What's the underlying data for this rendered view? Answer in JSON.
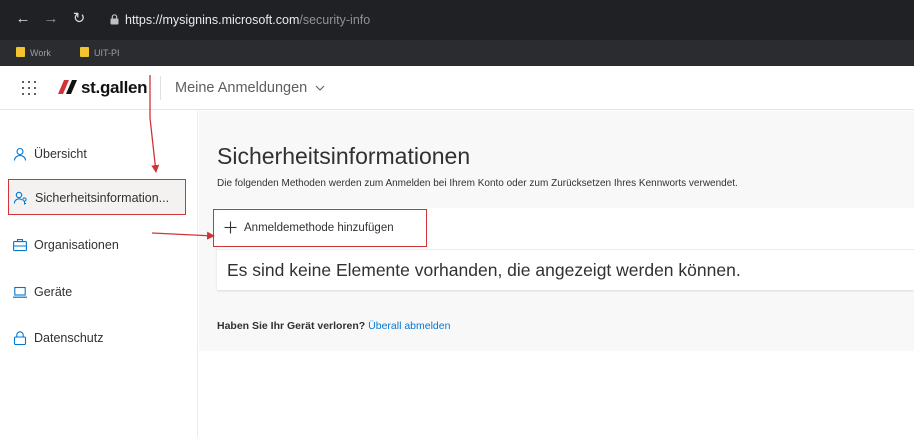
{
  "browser": {
    "url_host": "https://mysignins.microsoft.com",
    "url_path": "/security-info",
    "bookmarks": [
      {
        "label": "Work",
        "icon": "folder-icon"
      },
      {
        "label": "UIT-PI",
        "icon": "folder-icon"
      }
    ]
  },
  "header": {
    "logo_text": "st.gallen",
    "app_title": "Meine Anmeldungen"
  },
  "sidebar": {
    "items": [
      {
        "label": "Übersicht",
        "icon": "person-icon",
        "active": false
      },
      {
        "label": "Sicherheitsinformation...",
        "icon": "person-key-icon",
        "active": true
      },
      {
        "label": "Organisationen",
        "icon": "briefcase-icon",
        "active": false
      },
      {
        "label": "Geräte",
        "icon": "laptop-icon",
        "active": false
      },
      {
        "label": "Datenschutz",
        "icon": "lock-icon",
        "active": false
      }
    ]
  },
  "main": {
    "title": "Sicherheitsinformationen",
    "description": "Die folgenden Methoden werden zum Anmelden bei Ihrem Konto oder zum Zurücksetzen Ihres Kennworts verwendet.",
    "add_method_label": "Anmeldemethode hinzufügen",
    "empty_message": "Es sind keine Elemente vorhanden, die angezeigt werden können.",
    "lost_device_question": "Haben Sie Ihr Gerät verloren?",
    "lost_device_link": "Überall abmelden"
  },
  "colors": {
    "accent": "#0078d4",
    "annotation": "#d13438",
    "browser_bg": "#202124"
  }
}
